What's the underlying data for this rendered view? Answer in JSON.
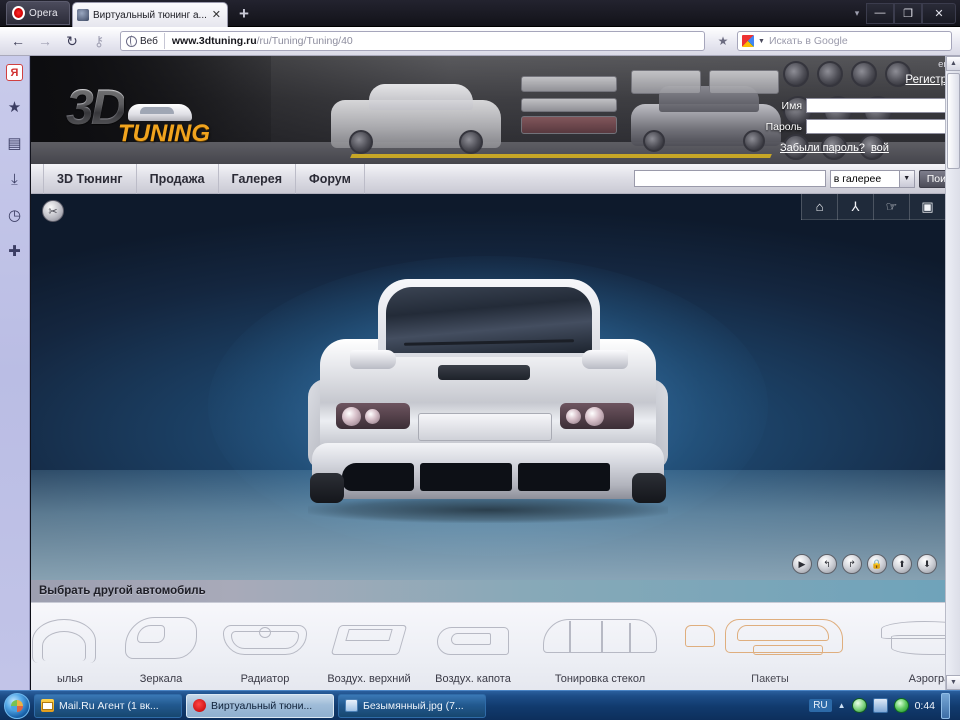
{
  "browser": {
    "app_button": "Opera",
    "tab_title": "Виртуальный тюнинг а...",
    "tab_close": "✕",
    "new_tab": "+",
    "back_icon": "←",
    "forward_icon": "→",
    "reload_icon": "↻",
    "key_icon": "⚷",
    "url_badge": "Веб",
    "url_bold": "www.3dtuning.ru",
    "url_rest": "/ru/Tuning/Tuning/40",
    "star_icon": "★",
    "search_placeholder": "Искать в Google",
    "search_chevron": "▼",
    "win_chevron": "▾",
    "win_minimize": "—",
    "win_restore": "❐",
    "win_close": "✕",
    "sidebar": [
      {
        "name": "yandex-icon",
        "glyph": "Я"
      },
      {
        "name": "bookmarks-icon",
        "glyph": "★"
      },
      {
        "name": "notes-icon",
        "glyph": "▤"
      },
      {
        "name": "downloads-icon",
        "glyph": "⤓"
      },
      {
        "name": "history-icon",
        "glyph": "◷"
      },
      {
        "name": "add-panel-icon",
        "glyph": "✚"
      }
    ]
  },
  "site": {
    "logo_3d": "3D",
    "logo_tuning": "TUNING",
    "lang_link": "eng",
    "register_link": "Регистрац",
    "name_label": "Имя",
    "password_label": "Пароль",
    "name_value": "",
    "password_value": "",
    "forgot_link": "Забыли пароль?",
    "login_link": "вой",
    "nav": [
      "3D Тюнинг",
      "Продажа",
      "Галерея",
      "Форум"
    ],
    "search_value": "",
    "search_scope": "в галерее",
    "search_scope_arrow": "▼",
    "search_button": "Пои"
  },
  "viewer": {
    "tools_icon": "✂",
    "toolbar": [
      {
        "name": "home-icon",
        "glyph": "⌂"
      },
      {
        "name": "transform-icon",
        "glyph": "⅄"
      },
      {
        "name": "lamp-icon",
        "glyph": "☞"
      },
      {
        "name": "camera-icon",
        "glyph": "▣"
      }
    ],
    "controls": [
      {
        "name": "play-button",
        "glyph": "▶"
      },
      {
        "name": "rotate-left-button",
        "glyph": "↰"
      },
      {
        "name": "rotate-right-button",
        "glyph": "↱"
      },
      {
        "name": "lock-button",
        "glyph": "🔒"
      },
      {
        "name": "move-up-button",
        "glyph": "⬆"
      },
      {
        "name": "move-down-button",
        "glyph": "⬇"
      }
    ],
    "choose_car_label": "Выбрать другой автомобиль"
  },
  "parts": [
    {
      "label": "ылья",
      "active": false
    },
    {
      "label": "Зеркала",
      "active": false
    },
    {
      "label": "Радиатор",
      "active": false
    },
    {
      "label": "Воздух. верхний",
      "active": false
    },
    {
      "label": "Воздух. капота",
      "active": false
    },
    {
      "label": "Тонировка стекол",
      "active": false
    },
    {
      "label": "Пакеты",
      "active": true
    },
    {
      "label": "Аэрография",
      "active": false
    }
  ],
  "scrollbars": {
    "left_arrow": "◄",
    "right_arrow": "►",
    "up_arrow": "▲",
    "down_arrow": "▼",
    "grip": "|||"
  },
  "taskbar": {
    "items": [
      {
        "label": "Mail.Ru Агент (1 вк...",
        "icon": "mail",
        "active": false
      },
      {
        "label": "Виртуальный тюни...",
        "icon": "opera",
        "active": true
      },
      {
        "label": "Безымянный.jpg (7...",
        "icon": "img",
        "active": false
      }
    ],
    "lang": "RU",
    "tray_chevron": "▲",
    "clock": "0:44"
  }
}
